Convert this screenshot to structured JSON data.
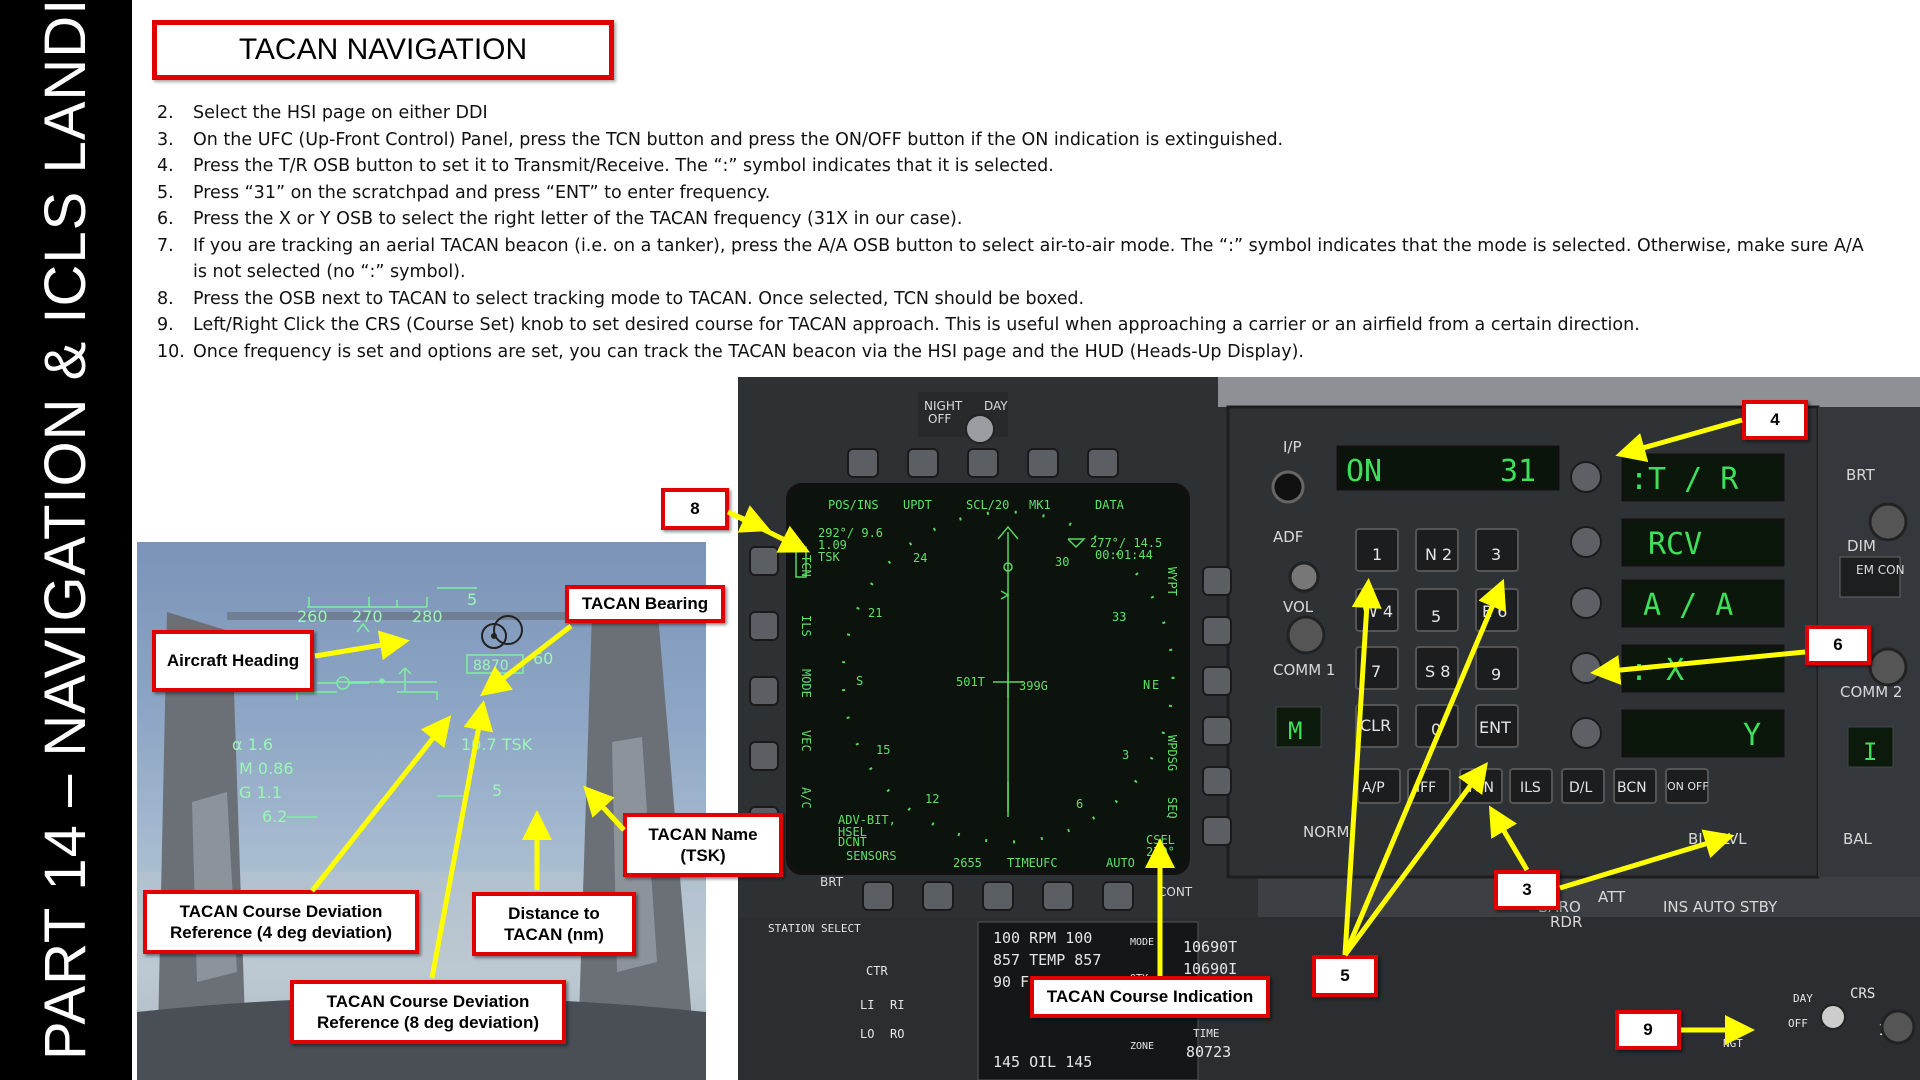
{
  "sidebar": {
    "title": "PART 14 – NAVIGATION & ICLS LANDING"
  },
  "page_title": "TACAN NAVIGATION",
  "steps": [
    {
      "num": "2.",
      "text": "Select the HSI page on either DDI"
    },
    {
      "num": "3.",
      "text": "On the UFC (Up-Front Control) Panel, press the TCN button and press the ON/OFF button if the ON indication is extinguished."
    },
    {
      "num": "4.",
      "text": "Press the T/R OSB button to set it to Transmit/Receive. The “:” symbol indicates that it is selected."
    },
    {
      "num": "5.",
      "text": "Press “31” on the scratchpad and press “ENT” to enter frequency."
    },
    {
      "num": "6.",
      "text": "Press the X or Y OSB to select the right letter of the TACAN frequency (31X in our case)."
    },
    {
      "num": "7.",
      "text": "If you are tracking an aerial TACAN beacon (i.e. on a tanker), press the A/A OSB button to select air-to-air mode. The “:” symbol indicates that the mode is selected. Otherwise, make sure A/A is not selected (no “:” symbol)."
    },
    {
      "num": "8.",
      "text": "Press the OSB next to TACAN to select tracking mode to TACAN. Once selected, TCN should be boxed."
    },
    {
      "num": "9.",
      "text": "Left/Right Click the CRS (Course Set) knob to set desired course for TACAN approach. This is useful when approaching a carrier or an airfield from a certain direction."
    },
    {
      "num": "10.",
      "text": "Once frequency is set and options are set, you can track the TACAN beacon via the HSI page and the HUD (Heads-Up Display)."
    }
  ],
  "callouts": {
    "tacan_bearing": "TACAN Bearing",
    "aircraft_heading": "Aircraft Heading",
    "tacan_name": "TACAN Name (TSK)",
    "distance": "Distance to TACAN (nm)",
    "course_dev_4": "TACAN Course Deviation Reference (4 deg deviation)",
    "course_dev_8": "TACAN Course Deviation Reference (8 deg deviation)",
    "course_indication": "TACAN Course Indication",
    "n3": "3",
    "n4": "4",
    "n5": "5",
    "n6": "6",
    "n8": "8",
    "n9": "9"
  },
  "hud": {
    "heading_ticks": [
      "260",
      "270",
      "280"
    ],
    "alt_box": "8870",
    "speed_60": "60",
    "alpha": "α 1.6",
    "mach": "M 0.86",
    "g": "G 1.1",
    "g_max": "6.2",
    "tacan_readout": "10.7 TSK",
    "ladder_5a": "5",
    "ladder_5b": "5"
  },
  "ddi": {
    "top_labels": [
      "POS/INS",
      "UPDT",
      "SCL/20",
      "MK1",
      "DATA"
    ],
    "left_labels": [
      "TCN",
      "ILS",
      "MODE",
      "VEC",
      "A/C"
    ],
    "right_labels": [
      "WYPT",
      "WPDSG",
      "SEQ"
    ],
    "bottom_labels": [
      "SENSORS",
      "2655",
      "TIMEUFC",
      "AUTO"
    ],
    "brg_left": "292°/ 9.6",
    "brg_left2": "1.09",
    "tsk": "TSK",
    "brg_right": "277°/ 14.5",
    "time_right": "00:01:44",
    "compass": [
      "24",
      "30",
      "33",
      "21",
      "15",
      "12",
      "6",
      "3",
      "S",
      "N",
      "E"
    ],
    "ac_left": "501T",
    "ac_right": "399G",
    "adv_bit": "ADV-BIT,",
    "hsel": "HSEL",
    "dcnt": "DCNT",
    "csel": "CSEL",
    "csel_val": "270°",
    "night": "NIGHT",
    "day": "DAY",
    "off": "OFF",
    "brt": "BRT",
    "cont": "CONT"
  },
  "ufc": {
    "ip": "I/P",
    "scratchpad_on": "ON",
    "scratchpad_val": "31",
    "options": [
      ":T / R",
      "RCV",
      "A / A",
      ":     X",
      "Y"
    ],
    "keys": [
      "1",
      "N 2",
      "3",
      "W 4",
      "5",
      "E 6",
      "7",
      "S 8",
      "9",
      "CLR",
      "0",
      "ENT"
    ],
    "function_keys": [
      "A/P",
      "IFF",
      "TCN",
      "ILS",
      "D/L",
      "BCN",
      "ON OFF"
    ],
    "adf": "ADF",
    "vol": "VOL",
    "comm1": "COMM 1",
    "comm2": "COMM 2",
    "brt": "BRT",
    "dim": "DIM",
    "em_con": "EM CON",
    "blk_lvl": "BLK LVL",
    "bal": "BAL",
    "m": "M",
    "i": "I",
    "norm": "NORM",
    "att": "ATT",
    "baro": "BARO",
    "rdr": "RDR",
    "ins": "INS AUTO STBY"
  },
  "lower": {
    "station_select": "STATION SELECT",
    "ctr": "CTR",
    "li": "LI",
    "ri": "RI",
    "lo": "LO",
    "ro": "RO",
    "rpm": "100 RPM 100",
    "temp": "857 TEMP 857",
    "ff": "90 FF 90",
    "oil": "145 OIL 145",
    "mode": "MODE",
    "qty": "QTY",
    "zone": "ZONE",
    "fuel1": "10690T",
    "fuel2": "10690I",
    "time_label": "TIME",
    "time_val": "80723",
    "crs": "CRS",
    "crs_val": "180",
    "day": "DAY",
    "off": "OFF",
    "brt": "BRT",
    "ngt": "NGT"
  }
}
